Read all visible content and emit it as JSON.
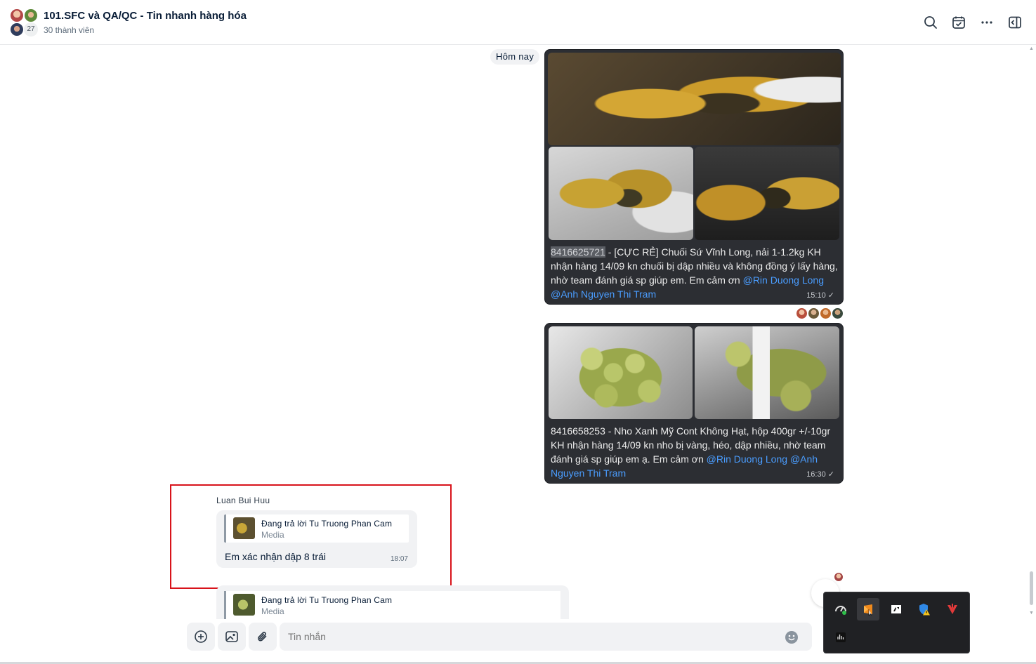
{
  "header": {
    "title": "101.SFC và QA/QC - Tin nhanh hàng hóa",
    "members": "30 thành viên",
    "avatar_count": "27",
    "icons": [
      "search-icon",
      "calendar-check-icon",
      "more-icon",
      "sidebar-toggle-icon"
    ]
  },
  "date_divider": "Hôm nay",
  "messages": {
    "m1": {
      "id_highlight": "8416625721",
      "text": " - [CỰC RẺ] Chuối Sứ Vĩnh Long, nải 1-1.2kg KH nhận hàng 14/09 kn chuối bị dập nhiều và không đồng ý lấy hàng, nhờ team đánh giá sp  giúp em. Em cảm ơn ",
      "mention1": "@Rin Duong Long",
      "mention2": "@Anh Nguyen Thi Tram",
      "time": "15:10 ✓"
    },
    "m2": {
      "text": "8416658253 - Nho Xanh Mỹ Cont Không Hạt, hộp 400gr +/-10gr   KH nhận hàng 14/09 kn nho bị vàng, héo, dập nhiều, nhờ team đánh giá sp giúp em ạ. Em cảm ơn ",
      "mention1": "@Rin Duong Long",
      "mention2": "@Anh Nguyen Thi Tram",
      "time": "16:30 ✓"
    },
    "m3": {
      "sender": "Luan Bui Huu",
      "quote_title": "Đang trả lời Tu Truong Phan Cam",
      "quote_sub": "Media",
      "text": "Em xác nhận dập 8 trái",
      "time": "18:07"
    },
    "m4": {
      "quote_title": "Đang trả lời Tu Truong Phan Cam",
      "quote_sub": "Media"
    }
  },
  "composer": {
    "placeholder": "Tin nhắn",
    "icons": [
      "add-icon",
      "image-icon",
      "attach-icon",
      "emoji-icon"
    ]
  },
  "tray": {
    "icons": [
      "network-icon",
      "app-orange-icon",
      "app-black-icon",
      "shield-warning-icon",
      "antivirus-red-icon",
      "audio-icon"
    ]
  },
  "colors": {
    "accent": "#0068ff",
    "mention": "#4a9dff",
    "highlight_box": "#d8131b",
    "dark_bubble": "#2c2e33"
  }
}
